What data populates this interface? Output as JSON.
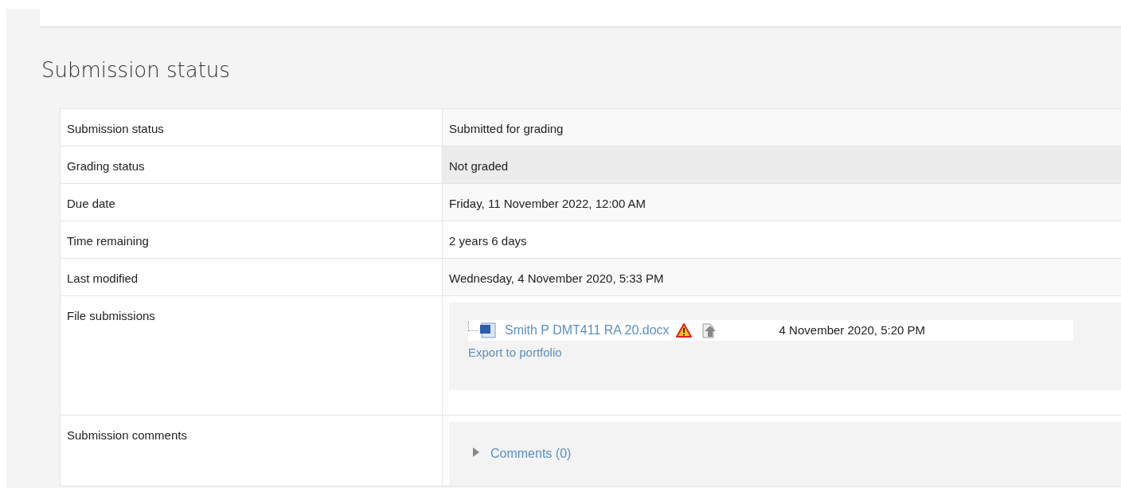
{
  "heading": "Submission status",
  "rows": [
    {
      "kind": "text",
      "label": "Submission status",
      "value": "Submitted for grading",
      "highlighted": false
    },
    {
      "kind": "text",
      "label": "Grading status",
      "value": "Not graded",
      "highlighted": true
    },
    {
      "kind": "text",
      "label": "Due date",
      "value": "Friday, 11 November 2022, 12:00 AM",
      "highlighted": false
    },
    {
      "kind": "text",
      "label": "Time remaining",
      "value": "2 years 6 days",
      "highlighted": false
    },
    {
      "kind": "text",
      "label": "Last modified",
      "value": "Wednesday, 4 November 2020, 5:33 PM",
      "highlighted": false
    },
    {
      "kind": "files",
      "label": "File submissions",
      "files": [
        {
          "name": "Smith P DMT411 RA 20.docx",
          "date": "4 November 2020, 5:20 PM",
          "warning": true
        }
      ],
      "export": "Export to portfolio"
    },
    {
      "kind": "comments",
      "label": "Submission comments",
      "link": "Comments (0)",
      "expanded": false
    }
  ]
}
